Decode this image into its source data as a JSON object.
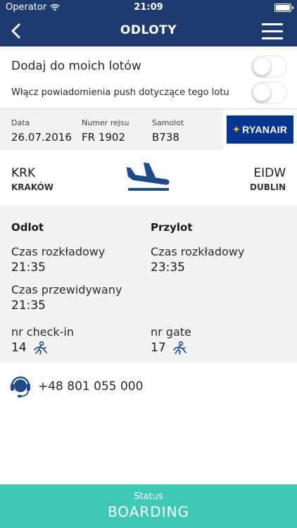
{
  "status_bar": {
    "carrier": "Operator",
    "time": "21:09"
  },
  "nav": {
    "title": "ODLOTY"
  },
  "toggles": {
    "add_label": "Dodaj do moich lotów",
    "add_on": false,
    "push_label": "Włącz powiadomienia push dotyczące tego lotu",
    "push_on": false
  },
  "flight": {
    "date_label": "Data",
    "date": "26.07.2016",
    "number_label": "Numer rejsu",
    "number": "FR 1902",
    "aircraft_label": "Samolot",
    "aircraft": "B738",
    "airline_logo_text": "RYANAIR"
  },
  "route": {
    "from_code": "KRK",
    "from_city": "KRAKÓW",
    "to_code": "EIDW",
    "to_city": "DUBLIN"
  },
  "departure": {
    "header": "Odlot",
    "scheduled_label": "Czas rozkładowy",
    "scheduled": "21:35",
    "expected_label": "Czas przewidywany",
    "expected": "21:35",
    "checkin_label": "nr check-in",
    "checkin": "14"
  },
  "arrival": {
    "header": "Przylot",
    "scheduled_label": "Czas rozkładowy",
    "scheduled": "23:35",
    "gate_label": "nr gate",
    "gate": "17"
  },
  "contact": {
    "phone": "+48 801 055 000"
  },
  "status": {
    "label": "Status",
    "value": "BOARDING"
  },
  "colors": {
    "nav_bg": "#1f3a6e",
    "section_bg": "#f2f2f2",
    "status_bg": "#3ec8b6",
    "airline_bg": "#073590",
    "icon_blue": "#1f4a8a"
  }
}
